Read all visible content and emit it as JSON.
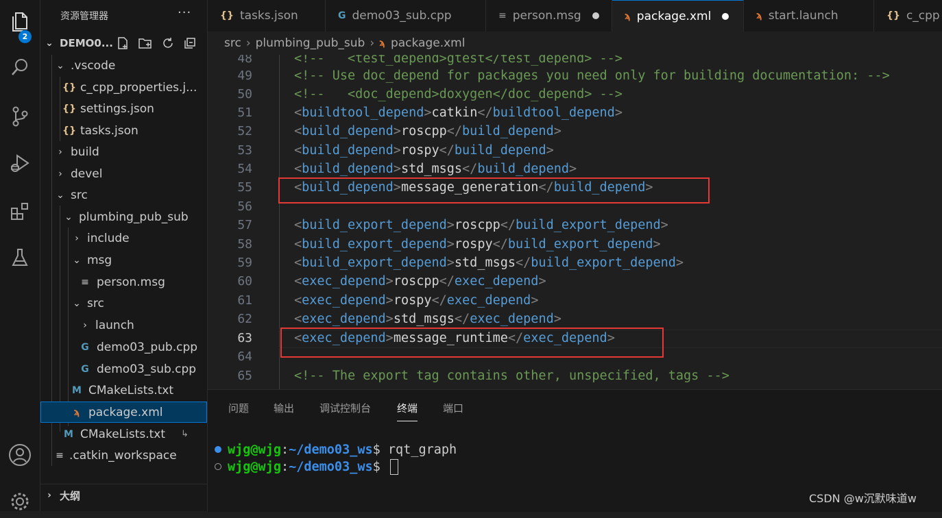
{
  "sidebar": {
    "title": "资源管理器",
    "more": "···",
    "badge": "2",
    "root": "DEMO0...",
    "tree": [
      {
        "label": ".vscode",
        "type": "folder-open"
      },
      {
        "label": "c_cpp_properties.j...",
        "type": "json"
      },
      {
        "label": "settings.json",
        "type": "json"
      },
      {
        "label": "tasks.json",
        "type": "json"
      },
      {
        "label": "build",
        "type": "folder"
      },
      {
        "label": "devel",
        "type": "folder"
      },
      {
        "label": "src",
        "type": "folder-open"
      },
      {
        "label": "plumbing_pub_sub",
        "type": "folder-open"
      },
      {
        "label": "include",
        "type": "folder"
      },
      {
        "label": "msg",
        "type": "folder-open"
      },
      {
        "label": "person.msg",
        "type": "text"
      },
      {
        "label": "src",
        "type": "folder-open"
      },
      {
        "label": "launch",
        "type": "folder"
      },
      {
        "label": "demo03_pub.cpp",
        "type": "cpp"
      },
      {
        "label": "demo03_sub.cpp",
        "type": "cpp"
      },
      {
        "label": "CMakeLists.txt",
        "type": "cmake"
      },
      {
        "label": "package.xml",
        "type": "xml"
      },
      {
        "label": "CMakeLists.txt",
        "type": "cmake"
      },
      {
        "label": ".catkin_workspace",
        "type": "text"
      }
    ],
    "outline": "大纲"
  },
  "tabs": [
    {
      "label": "tasks.json",
      "icon": "{}"
    },
    {
      "label": "demo03_sub.cpp",
      "icon": "C"
    },
    {
      "label": "person.msg",
      "icon": "≡"
    },
    {
      "label": "package.xml",
      "icon": "xml"
    },
    {
      "label": "start.launch",
      "icon": "xml"
    },
    {
      "label": "c_cpp",
      "icon": "{}"
    }
  ],
  "breadcrumb": {
    "part1": "src",
    "part2": "plumbing_pub_sub",
    "part3": "package.xml"
  },
  "editor": {
    "lines": [
      {
        "n": "48",
        "a": "<!--   ",
        "b": "<test_depend>gtest</test_depend>",
        "c": " -->"
      },
      {
        "n": "49",
        "comment": "<!-- Use doc_depend for packages you need only for building documentation: -->"
      },
      {
        "n": "50",
        "comment": "<!--   <doc_depend>doxygen</doc_depend> -->"
      },
      {
        "n": "51",
        "tag": "buildtool_depend",
        "text": "catkin"
      },
      {
        "n": "52",
        "tag": "build_depend",
        "text": "roscpp"
      },
      {
        "n": "53",
        "tag": "build_depend",
        "text": "rospy"
      },
      {
        "n": "54",
        "tag": "build_depend",
        "text": "std_msgs"
      },
      {
        "n": "55",
        "tag": "build_depend",
        "text": "message_generation"
      },
      {
        "n": "56"
      },
      {
        "n": "57",
        "tag": "build_export_depend",
        "text": "roscpp"
      },
      {
        "n": "58",
        "tag": "build_export_depend",
        "text": "rospy"
      },
      {
        "n": "59",
        "tag": "build_export_depend",
        "text": "std_msgs"
      },
      {
        "n": "60",
        "tag": "exec_depend",
        "text": "roscpp"
      },
      {
        "n": "61",
        "tag": "exec_depend",
        "text": "rospy"
      },
      {
        "n": "62",
        "tag": "exec_depend",
        "text": "std_msgs"
      },
      {
        "n": "63",
        "tag": "exec_depend",
        "text": "message_runtime"
      },
      {
        "n": "64"
      },
      {
        "n": "65",
        "comment": "<!-- The export tag contains other, unspecified, tags -->"
      }
    ]
  },
  "panel": {
    "tabs": [
      "问题",
      "输出",
      "调试控制台",
      "终端",
      "端口"
    ],
    "active": "终端",
    "terminal": [
      {
        "user": "wjg@wjg",
        "sep": ":",
        "path": "~/demo03_ws",
        "prompt": "$ ",
        "cmd": "rqt_graph"
      },
      {
        "user": "wjg@wjg",
        "sep": ":",
        "path": "~/demo03_ws",
        "prompt": "$ ",
        "cmd": ""
      }
    ]
  },
  "watermark": "CSDN @w沉默味道w",
  "colors": {
    "accent": "#0078d4",
    "highlight": "#e53935",
    "tag": "#569cd6",
    "comment": "#6a9955"
  }
}
